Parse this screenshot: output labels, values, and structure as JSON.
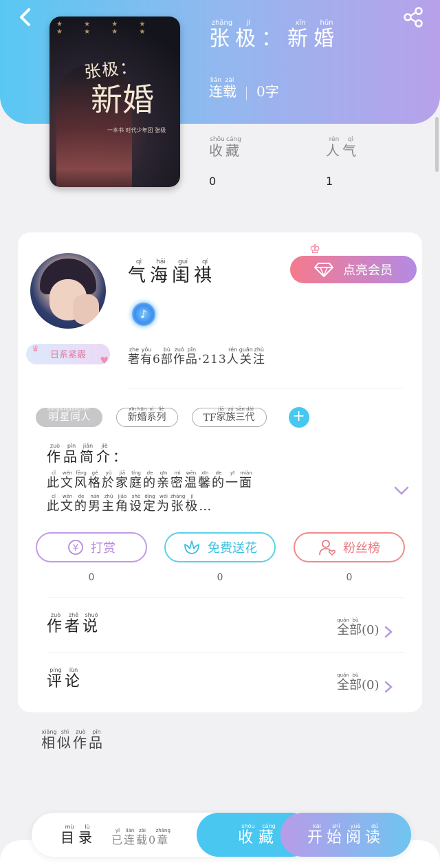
{
  "book": {
    "title_chars": [
      [
        "张",
        "zhāng"
      ],
      [
        "极",
        "jí"
      ],
      [
        "：",
        ""
      ],
      [
        "新",
        "xīn"
      ],
      [
        "婚",
        "hūn"
      ]
    ],
    "status_chars": [
      [
        "连",
        "lián"
      ],
      [
        "载",
        "zài"
      ]
    ],
    "word_count": "0字",
    "cover": {
      "title_small": "张极：",
      "title_big": "新婚",
      "subtitle": "一本书 时代少年团 张极"
    }
  },
  "stats": {
    "favorites": {
      "chars": [
        [
          "收",
          "shōu"
        ],
        [
          "藏",
          "cáng"
        ]
      ],
      "value": "0"
    },
    "popularity": {
      "chars": [
        [
          "人",
          "rén"
        ],
        [
          "气",
          "qì"
        ]
      ],
      "value": "1"
    }
  },
  "author": {
    "name_chars": [
      [
        "气",
        "qì"
      ],
      [
        "海",
        "hǎi"
      ],
      [
        "闺",
        "guī"
      ],
      [
        "祺",
        "qí"
      ]
    ],
    "badge": "日系紧霰",
    "works_chars": [
      [
        "著",
        "zhe"
      ],
      [
        "有",
        "yǒu"
      ],
      [
        "6",
        ""
      ],
      [
        "部",
        "bù"
      ],
      [
        "作",
        "zuò"
      ],
      [
        "品",
        "pǐn"
      ],
      [
        "·213",
        ""
      ],
      [
        "人",
        "rén"
      ],
      [
        "关",
        "guān"
      ],
      [
        "注",
        "zhù"
      ]
    ],
    "vip_label": "点亮会员"
  },
  "tags": [
    {
      "chars": [
        [
          "明",
          "míng"
        ],
        [
          "星",
          "xīng"
        ],
        [
          "同",
          "tóng"
        ],
        [
          "人",
          "rén"
        ]
      ],
      "filled": true
    },
    {
      "chars": [
        [
          "新",
          "xīn"
        ],
        [
          "婚",
          "hūn"
        ],
        [
          "系",
          "xì"
        ],
        [
          "列",
          "liè"
        ]
      ],
      "filled": false
    },
    {
      "chars": [
        [
          "TF",
          ""
        ],
        [
          "家",
          "jiā"
        ],
        [
          "族",
          "zú"
        ],
        [
          "三",
          "sān"
        ],
        [
          "代",
          "dài"
        ]
      ],
      "filled": false
    }
  ],
  "intro": {
    "heading_chars": [
      [
        "作",
        "zuò"
      ],
      [
        "品",
        "pǐn"
      ],
      [
        "简",
        "jiǎn"
      ],
      [
        "介",
        "jiè"
      ],
      [
        "：",
        ""
      ]
    ],
    "line1_chars": [
      [
        "此",
        "cǐ"
      ],
      [
        "文",
        "wén"
      ],
      [
        "风",
        "fēng"
      ],
      [
        "格",
        "gé"
      ],
      [
        "於",
        "yú"
      ],
      [
        "家",
        "jiā"
      ],
      [
        "庭",
        "tíng"
      ],
      [
        "的",
        "de"
      ],
      [
        "亲",
        "qīn"
      ],
      [
        "密",
        "mì"
      ],
      [
        "温",
        "wēn"
      ],
      [
        "馨",
        "xīn"
      ],
      [
        "的",
        "de"
      ],
      [
        "一",
        "yī"
      ],
      [
        "面",
        "miàn"
      ]
    ],
    "line2_chars": [
      [
        "此",
        "cǐ"
      ],
      [
        "文",
        "wén"
      ],
      [
        "的",
        "de"
      ],
      [
        "男",
        "nán"
      ],
      [
        "主",
        "zhǔ"
      ],
      [
        "角",
        "jiǎo"
      ],
      [
        "设",
        "shè"
      ],
      [
        "定",
        "dìng"
      ],
      [
        "为",
        "wéi"
      ],
      [
        "张",
        "zhāng"
      ],
      [
        "极",
        "jí"
      ],
      [
        "…",
        ""
      ]
    ]
  },
  "actions": [
    {
      "label": "打赏",
      "count": "0",
      "icon": "yen-coin-icon"
    },
    {
      "label": "免费送花",
      "count": "0",
      "icon": "flower-icon"
    },
    {
      "label": "粉丝榜",
      "count": "0",
      "icon": "fan-user-icon"
    }
  ],
  "sections": {
    "author_says": {
      "chars": [
        [
          "作",
          "zuò"
        ],
        [
          "者",
          "zhě"
        ],
        [
          "说",
          "shuō"
        ]
      ],
      "meta_chars": [
        [
          "全",
          "quán"
        ],
        [
          "部",
          "bù"
        ],
        [
          "(0)",
          ""
        ]
      ]
    },
    "comments": {
      "chars": [
        [
          "评",
          "píng"
        ],
        [
          "论",
          "lùn"
        ]
      ],
      "meta_chars": [
        [
          "全",
          "quán"
        ],
        [
          "部",
          "bù"
        ],
        [
          "(0)",
          ""
        ]
      ]
    }
  },
  "similar": {
    "chars": [
      [
        "相",
        "xiāng"
      ],
      [
        "似",
        "shì"
      ],
      [
        "作",
        "zuò"
      ],
      [
        "品",
        "pǐn"
      ]
    ]
  },
  "bottom_bar": {
    "toc_chars": [
      [
        "目",
        "mù"
      ],
      [
        "录",
        "lù"
      ]
    ],
    "status_chars": [
      [
        "已",
        "yǐ"
      ],
      [
        "连",
        "lián"
      ],
      [
        "载",
        "zài"
      ],
      [
        "0",
        ""
      ],
      [
        "章",
        "zhāng"
      ]
    ],
    "fav_chars": [
      [
        "收",
        "shōu"
      ],
      [
        "藏",
        "cáng"
      ]
    ],
    "read_chars": [
      [
        "开",
        "kāi"
      ],
      [
        "始",
        "shǐ"
      ],
      [
        "阅",
        "yuè"
      ],
      [
        "读",
        "dú"
      ]
    ]
  },
  "colors": {
    "header_start": "#58c8f2",
    "header_end": "#b8a1ea",
    "accent_blue": "#49c7f1",
    "vip_pink": "#f57a8d"
  }
}
